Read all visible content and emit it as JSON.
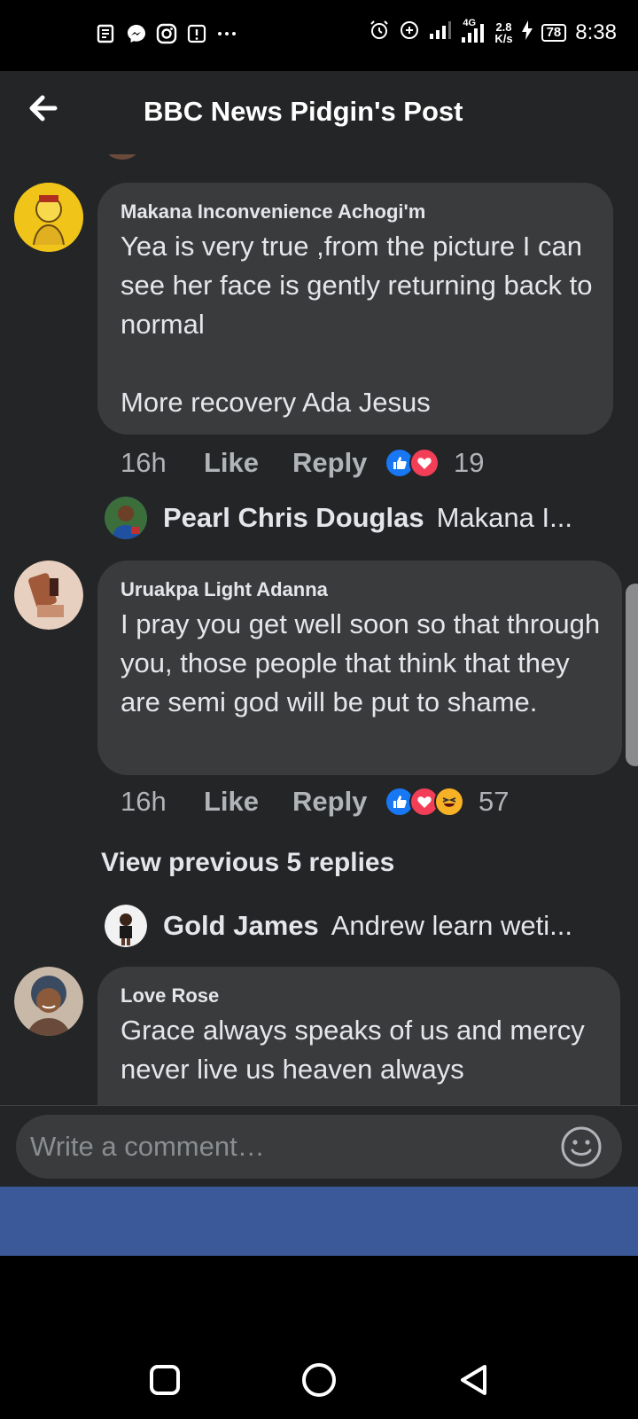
{
  "status_bar": {
    "network_type": "4G",
    "speed_value": "2.8",
    "speed_unit": "K/s",
    "battery": "78",
    "time": "8:38"
  },
  "header": {
    "title": "BBC News Pidgin's Post",
    "back_icon": "arrow-left-icon"
  },
  "comments": [
    {
      "author": "Makana Inconvenience Achogi'm",
      "text": "Yea is very true ,from the picture I can see her face is gently returning back to normal\n\nMore recovery Ada Jesus",
      "time": "16h",
      "like_label": "Like",
      "reply_label": "Reply",
      "reactions": [
        "like",
        "love"
      ],
      "reaction_count": "19",
      "reply_preview": {
        "name": "Pearl Chris Douglas",
        "text": "Makana I..."
      }
    },
    {
      "author": "Uruakpa Light Adanna",
      "text": "I pray you get well soon so that through you, those people that think that they are semi god will be put to shame.",
      "time": "16h",
      "like_label": "Like",
      "reply_label": "Reply",
      "reactions": [
        "like",
        "love",
        "haha"
      ],
      "reaction_count": "57",
      "view_previous": "View previous 5 replies",
      "reply_preview": {
        "name": "Gold James",
        "text": "Andrew learn weti..."
      }
    },
    {
      "author": "Love Rose",
      "text": "Grace always speaks of us and mercy never live us heaven always"
    }
  ],
  "composer": {
    "placeholder": "Write a comment…",
    "emoji_icon": "smiley-icon"
  },
  "nav": {
    "recents_icon": "square-icon",
    "home_icon": "circle-icon",
    "back_icon": "triangle-back-icon"
  },
  "colors": {
    "background": "#242526",
    "bubble": "#3a3b3c",
    "text": "#e4e6eb",
    "muted": "#b0b3b8",
    "like_blue": "#1877f2",
    "love_red": "#f33e58",
    "haha_yellow": "#f7b125",
    "strip_blue": "#3b5998"
  }
}
